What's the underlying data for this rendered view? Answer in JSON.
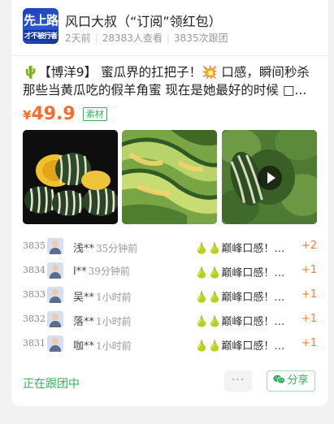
{
  "author": {
    "avatar_text_top": "先上路",
    "avatar_text_bottom": "才不被行者",
    "name": "风口大叔（“订阅”领红包）",
    "posted": "2天前",
    "views": "28383人查看",
    "joins": "3835次跟团"
  },
  "post": {
    "title": "🌵【博洋9】 蜜瓜界的扛把子！💥 口感，瞬间秒杀那些当黄瓜吃的假羊角蜜 现在是她最好的时候 □...",
    "currency": "¥",
    "price": "49.9",
    "tag": "素材",
    "images": [
      "melon-photo",
      "melon-slices-photo",
      "melon-field-video"
    ]
  },
  "orders": [
    {
      "num": "3835",
      "name": "浅**",
      "time": "35分钟前",
      "product": "🍐🍐巅峰口感！博洋9...",
      "qty": "+2"
    },
    {
      "num": "3834",
      "name": "l**",
      "time": "39分钟前",
      "product": "🍐🍐巅峰口感！博洋9...",
      "qty": "+1"
    },
    {
      "num": "3833",
      "name": "吴**",
      "time": "1小时前",
      "product": "🍐🍐巅峰口感！博洋9...",
      "qty": "+1"
    },
    {
      "num": "3832",
      "name": "落**",
      "time": "1小时前",
      "product": "🍐🍐巅峰口感！博洋9...",
      "qty": "+1"
    },
    {
      "num": "3831",
      "name": "咖**",
      "time": "1小时前",
      "product": "🍐🍐巅峰口感！博洋9...",
      "qty": "+1"
    }
  ],
  "footer": {
    "status": "正在跟团中",
    "more": "···",
    "share": "分享"
  },
  "colors": {
    "accent_green": "#2fb35a",
    "price_orange": "#ff6a2b"
  }
}
